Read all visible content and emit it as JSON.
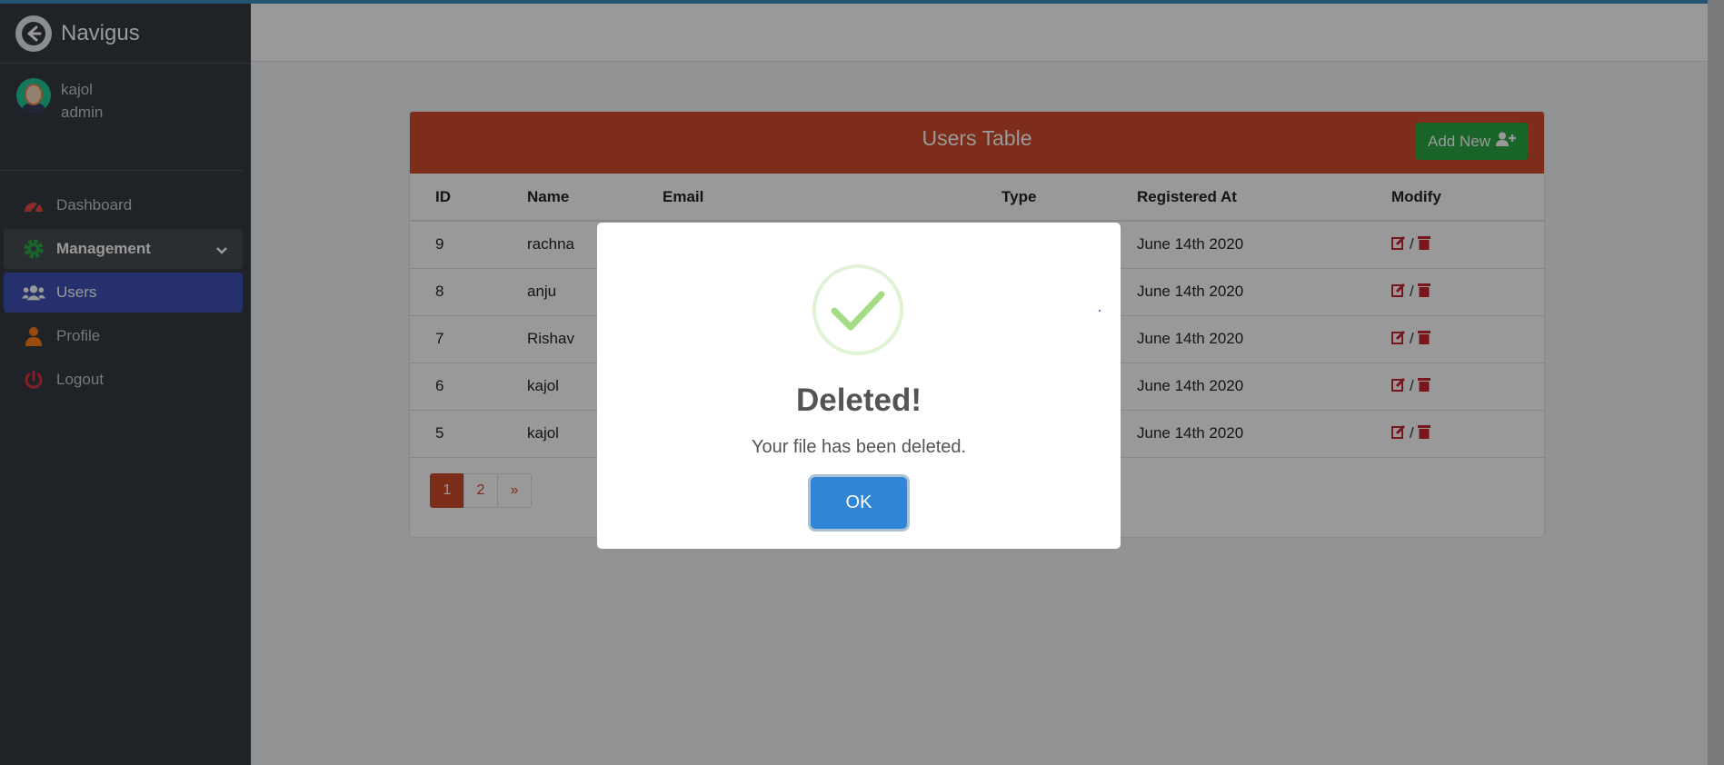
{
  "brand": {
    "name": "Navigus"
  },
  "user": {
    "name": "kajol",
    "role": "admin"
  },
  "sidebar": {
    "items": [
      {
        "label": "Dashboard",
        "icon": "tachometer-icon",
        "color": "#e74c3c"
      },
      {
        "label": "Management",
        "icon": "gear-icon",
        "color": "#28a745"
      },
      {
        "label": "Users",
        "icon": "users-icon",
        "color": "#ffffff"
      },
      {
        "label": "Profile",
        "icon": "user-icon",
        "color": "#fd7e14"
      },
      {
        "label": "Logout",
        "icon": "power-icon",
        "color": "#dc3545"
      }
    ]
  },
  "card": {
    "title": "Users Table",
    "add_button": "Add New",
    "columns": [
      "ID",
      "Name",
      "Email",
      "Type",
      "Registered At",
      "Modify"
    ],
    "rows": [
      {
        "id": "9",
        "name": "rachna",
        "registered": "June 14th 2020"
      },
      {
        "id": "8",
        "name": "anju",
        "registered": "June 14th 2020"
      },
      {
        "id": "7",
        "name": "Rishav",
        "registered": "June 14th 2020"
      },
      {
        "id": "6",
        "name": "kajol",
        "registered": "June 14th 2020"
      },
      {
        "id": "5",
        "name": "kajol",
        "registered": "June 14th 2020"
      }
    ],
    "modify_separator": "/",
    "pagination": [
      "1",
      "2",
      "»"
    ]
  },
  "modal": {
    "title": "Deleted!",
    "text": "Your file has been deleted.",
    "ok": "OK"
  },
  "colors": {
    "header": "#d24b2c",
    "active_nav": "#3f51b5",
    "add_button": "#28a745",
    "ok_button": "#3085d6",
    "success_check": "#a5dc86"
  }
}
